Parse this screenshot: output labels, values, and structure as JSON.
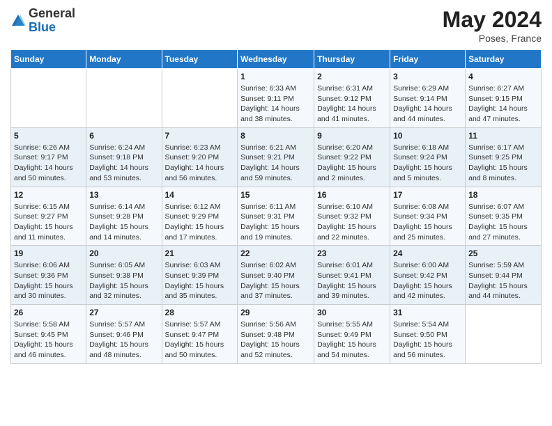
{
  "header": {
    "logo_line1": "General",
    "logo_line2": "Blue",
    "month_year": "May 2024",
    "location": "Poses, France"
  },
  "weekdays": [
    "Sunday",
    "Monday",
    "Tuesday",
    "Wednesday",
    "Thursday",
    "Friday",
    "Saturday"
  ],
  "weeks": [
    [
      {
        "day": "",
        "info": ""
      },
      {
        "day": "",
        "info": ""
      },
      {
        "day": "",
        "info": ""
      },
      {
        "day": "1",
        "info": "Sunrise: 6:33 AM\nSunset: 9:11 PM\nDaylight: 14 hours\nand 38 minutes."
      },
      {
        "day": "2",
        "info": "Sunrise: 6:31 AM\nSunset: 9:12 PM\nDaylight: 14 hours\nand 41 minutes."
      },
      {
        "day": "3",
        "info": "Sunrise: 6:29 AM\nSunset: 9:14 PM\nDaylight: 14 hours\nand 44 minutes."
      },
      {
        "day": "4",
        "info": "Sunrise: 6:27 AM\nSunset: 9:15 PM\nDaylight: 14 hours\nand 47 minutes."
      }
    ],
    [
      {
        "day": "5",
        "info": "Sunrise: 6:26 AM\nSunset: 9:17 PM\nDaylight: 14 hours\nand 50 minutes."
      },
      {
        "day": "6",
        "info": "Sunrise: 6:24 AM\nSunset: 9:18 PM\nDaylight: 14 hours\nand 53 minutes."
      },
      {
        "day": "7",
        "info": "Sunrise: 6:23 AM\nSunset: 9:20 PM\nDaylight: 14 hours\nand 56 minutes."
      },
      {
        "day": "8",
        "info": "Sunrise: 6:21 AM\nSunset: 9:21 PM\nDaylight: 14 hours\nand 59 minutes."
      },
      {
        "day": "9",
        "info": "Sunrise: 6:20 AM\nSunset: 9:22 PM\nDaylight: 15 hours\nand 2 minutes."
      },
      {
        "day": "10",
        "info": "Sunrise: 6:18 AM\nSunset: 9:24 PM\nDaylight: 15 hours\nand 5 minutes."
      },
      {
        "day": "11",
        "info": "Sunrise: 6:17 AM\nSunset: 9:25 PM\nDaylight: 15 hours\nand 8 minutes."
      }
    ],
    [
      {
        "day": "12",
        "info": "Sunrise: 6:15 AM\nSunset: 9:27 PM\nDaylight: 15 hours\nand 11 minutes."
      },
      {
        "day": "13",
        "info": "Sunrise: 6:14 AM\nSunset: 9:28 PM\nDaylight: 15 hours\nand 14 minutes."
      },
      {
        "day": "14",
        "info": "Sunrise: 6:12 AM\nSunset: 9:29 PM\nDaylight: 15 hours\nand 17 minutes."
      },
      {
        "day": "15",
        "info": "Sunrise: 6:11 AM\nSunset: 9:31 PM\nDaylight: 15 hours\nand 19 minutes."
      },
      {
        "day": "16",
        "info": "Sunrise: 6:10 AM\nSunset: 9:32 PM\nDaylight: 15 hours\nand 22 minutes."
      },
      {
        "day": "17",
        "info": "Sunrise: 6:08 AM\nSunset: 9:34 PM\nDaylight: 15 hours\nand 25 minutes."
      },
      {
        "day": "18",
        "info": "Sunrise: 6:07 AM\nSunset: 9:35 PM\nDaylight: 15 hours\nand 27 minutes."
      }
    ],
    [
      {
        "day": "19",
        "info": "Sunrise: 6:06 AM\nSunset: 9:36 PM\nDaylight: 15 hours\nand 30 minutes."
      },
      {
        "day": "20",
        "info": "Sunrise: 6:05 AM\nSunset: 9:38 PM\nDaylight: 15 hours\nand 32 minutes."
      },
      {
        "day": "21",
        "info": "Sunrise: 6:03 AM\nSunset: 9:39 PM\nDaylight: 15 hours\nand 35 minutes."
      },
      {
        "day": "22",
        "info": "Sunrise: 6:02 AM\nSunset: 9:40 PM\nDaylight: 15 hours\nand 37 minutes."
      },
      {
        "day": "23",
        "info": "Sunrise: 6:01 AM\nSunset: 9:41 PM\nDaylight: 15 hours\nand 39 minutes."
      },
      {
        "day": "24",
        "info": "Sunrise: 6:00 AM\nSunset: 9:42 PM\nDaylight: 15 hours\nand 42 minutes."
      },
      {
        "day": "25",
        "info": "Sunrise: 5:59 AM\nSunset: 9:44 PM\nDaylight: 15 hours\nand 44 minutes."
      }
    ],
    [
      {
        "day": "26",
        "info": "Sunrise: 5:58 AM\nSunset: 9:45 PM\nDaylight: 15 hours\nand 46 minutes."
      },
      {
        "day": "27",
        "info": "Sunrise: 5:57 AM\nSunset: 9:46 PM\nDaylight: 15 hours\nand 48 minutes."
      },
      {
        "day": "28",
        "info": "Sunrise: 5:57 AM\nSunset: 9:47 PM\nDaylight: 15 hours\nand 50 minutes."
      },
      {
        "day": "29",
        "info": "Sunrise: 5:56 AM\nSunset: 9:48 PM\nDaylight: 15 hours\nand 52 minutes."
      },
      {
        "day": "30",
        "info": "Sunrise: 5:55 AM\nSunset: 9:49 PM\nDaylight: 15 hours\nand 54 minutes."
      },
      {
        "day": "31",
        "info": "Sunrise: 5:54 AM\nSunset: 9:50 PM\nDaylight: 15 hours\nand 56 minutes."
      },
      {
        "day": "",
        "info": ""
      }
    ]
  ]
}
